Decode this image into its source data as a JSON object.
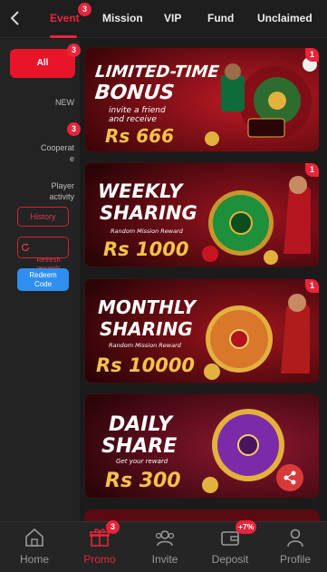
{
  "top_tabs": [
    {
      "label": "Event",
      "badge": "3",
      "active": true
    },
    {
      "label": "Mission"
    },
    {
      "label": "VIP"
    },
    {
      "label": "Fund"
    },
    {
      "label": "Unclaimed"
    }
  ],
  "sidebar": {
    "all_label": "All",
    "all_badge": "3",
    "items": [
      {
        "label": "NEW"
      },
      {
        "label": "Cooperat\ne",
        "badge": "3"
      },
      {
        "label": "Player\nactivity"
      }
    ],
    "history_label": "History",
    "refresh_label": "Refresh\nrewards",
    "redeem_label": "Redeem\nCode"
  },
  "banners": [
    {
      "title1": "LIMITED-TIME",
      "title2": "BONUS",
      "sub1": "invite a friend",
      "sub2": "and receive",
      "amount": "Rs 666",
      "badge": "1",
      "colors": {
        "bg": "#6e0c14",
        "accent": "#e21b2a"
      }
    },
    {
      "title1": "WEEKLY",
      "title2": "SHARING",
      "sub1": "Random Mission Reward",
      "amount": "Rs 1000",
      "badge": "1",
      "colors": {
        "bg": "#5c0a12",
        "accent": "#1e8f3a"
      }
    },
    {
      "title1": "MONTHLY",
      "title2": "SHARING",
      "sub1": "Random Mission Reward",
      "amount": "Rs 10000",
      "badge": "1",
      "colors": {
        "bg": "#5e0b10",
        "accent": "#d9772a"
      }
    },
    {
      "title1": "DAILY",
      "title2": "SHARE",
      "sub1": "Get your reward",
      "amount": "Rs 300",
      "badge": "",
      "colors": {
        "bg": "#55101c",
        "accent": "#7b2aa8"
      }
    }
  ],
  "bottom_nav": [
    {
      "label": "Home",
      "icon": "home-icon"
    },
    {
      "label": "Promo",
      "icon": "gift-icon",
      "badge": "3",
      "active": true
    },
    {
      "label": "Invite",
      "icon": "users-icon"
    },
    {
      "label": "Deposit",
      "icon": "wallet-icon",
      "badge": "+7%"
    },
    {
      "label": "Profile",
      "icon": "person-icon"
    }
  ],
  "colors": {
    "accent": "#e8253b",
    "redeem": "#2f8ff0"
  }
}
